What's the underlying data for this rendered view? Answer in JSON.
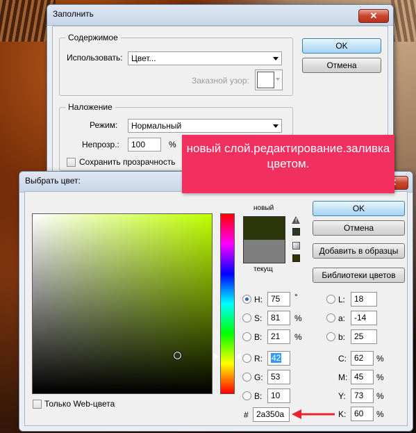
{
  "fill_dialog": {
    "title": "Заполнить",
    "close_glyph": "✕",
    "contents": {
      "legend": "Содержимое",
      "use_label": "Использовать:",
      "use_value": "Цвет...",
      "pattern_label": "Заказной узор:"
    },
    "blending": {
      "legend": "Наложение",
      "mode_label": "Режим:",
      "mode_value": "Нормальный",
      "opacity_label": "Непрозр.:",
      "opacity_value": "100",
      "opacity_unit": "%",
      "preserve_label": "Сохранить прозрачность"
    },
    "ok": "OK",
    "cancel": "Отмена"
  },
  "callout": {
    "text": "новый слой.редактирование.заливка цветом.",
    "color": "#f1305f"
  },
  "picker": {
    "title": "Выбрать цвет:",
    "close_glyph": "✕",
    "hue_deg": 75,
    "cursor_saturation": 0.81,
    "cursor_brightness": 0.21,
    "new_label": "новый",
    "current_label": "текущ",
    "new_color": "#2a350a",
    "current_color": "#7f7f7f",
    "ok": "OK",
    "cancel": "Отмена",
    "add_swatches": "Добавить в образцы",
    "libraries": "Библиотеки цветов",
    "web_only": "Только Web-цвета",
    "hsb": [
      {
        "label": "H:",
        "value": "75",
        "unit": "°",
        "selected": true
      },
      {
        "label": "S:",
        "value": "81",
        "unit": "%",
        "selected": false
      },
      {
        "label": "B:",
        "value": "21",
        "unit": "%",
        "selected": false
      }
    ],
    "rgb": [
      {
        "label": "R:",
        "value": "42"
      },
      {
        "label": "G:",
        "value": "53"
      },
      {
        "label": "B:",
        "value": "10"
      }
    ],
    "lab": [
      {
        "label": "L:",
        "value": "18"
      },
      {
        "label": "a:",
        "value": "-14"
      },
      {
        "label": "b:",
        "value": "25"
      }
    ],
    "cmyk": [
      {
        "label": "C:",
        "value": "62",
        "unit": "%"
      },
      {
        "label": "M:",
        "value": "45",
        "unit": "%"
      },
      {
        "label": "Y:",
        "value": "73",
        "unit": "%"
      },
      {
        "label": "K:",
        "value": "60",
        "unit": "%"
      }
    ],
    "hex_label": "#",
    "hex_value": "2a350a",
    "arrow_color": "#e8232e"
  }
}
